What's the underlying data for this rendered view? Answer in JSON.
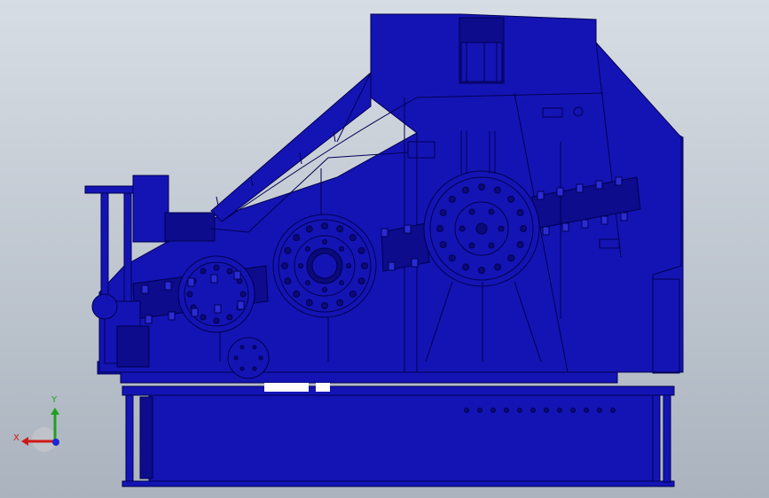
{
  "viewport": {
    "background_top": "#d7dde4",
    "background_bottom": "#aab3be"
  },
  "model": {
    "fill": "#1414b4",
    "fill_dark": "#0c0c8c",
    "edge": "#000050",
    "highlight": "#2b2bd6",
    "white_gap": "#ffffff",
    "hole_fill": "#0a0a78"
  },
  "triad": {
    "x_label": "X",
    "y_label": "Y",
    "x_color": "#d01818",
    "y_color": "#1fa01f",
    "z_color": "#1a28d8"
  }
}
